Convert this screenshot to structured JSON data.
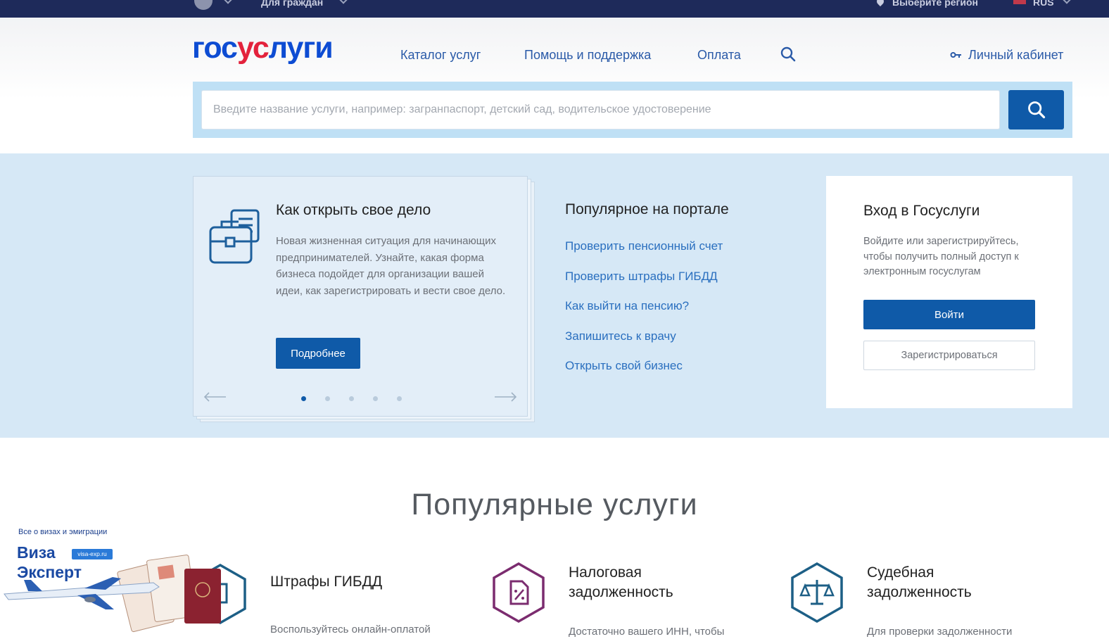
{
  "topbar": {
    "citizens_label": "Для граждан",
    "region_label": "Выберите регион",
    "lang_label": "RUS"
  },
  "header": {
    "logo_part1": "гос",
    "logo_part2": "ус",
    "logo_part3": "луги",
    "nav": [
      "Каталог услуг",
      "Помощь и поддержка",
      "Оплата"
    ],
    "cabinet_label": "Личный кабинет",
    "search_placeholder": "Введите название услуги, например: загранпаспорт, детский сад, водительское удостоверение"
  },
  "hero_card": {
    "title": "Как открыть свое дело",
    "text": "Новая жизненная ситуация для начинающих предпринимателей. Узнайте, какая форма бизнеса подойдет для организации вашей идеи, как зарегистрировать и вести свое дело.",
    "button": "Подробнее",
    "slides_total": 5,
    "slide_active": 1
  },
  "popular": {
    "title": "Популярное на портале",
    "links": [
      "Проверить пенсионный счет",
      "Проверить штрафы ГИБДД",
      "Как выйти на пенсию?",
      "Запишитесь к врачу",
      "Открыть свой бизнес"
    ]
  },
  "login": {
    "title": "Вход в Госуслуги",
    "text": "Войдите или зарегистрируйтесь, чтобы получить полный доступ к электронным госуслугам",
    "enter_button": "Войти",
    "register_button": "Зарегистрироваться"
  },
  "services": {
    "title": "Популярные услуги",
    "items": [
      {
        "title": "Штрафы ГИБДД",
        "desc": "Воспользуйтесь онлайн-оплатой",
        "icon": "document-icon"
      },
      {
        "title": "Налоговая\nзадолженность",
        "desc": "Достаточно вашего ИНН, чтобы",
        "icon": "tax-document-icon"
      },
      {
        "title": "Судебная\nзадолженность",
        "desc": "Для проверки задолженности",
        "icon": "scales-icon"
      }
    ]
  },
  "watermark": {
    "tagline": "Все о визах и эмиграции",
    "name_line1": "Виза",
    "name_line2": "Эксперт",
    "site": "visa-exp.ru"
  },
  "colors": {
    "topbar": "#1e2a5a",
    "primary": "#0f5aa8",
    "logo_blue": "#0d4cd3",
    "logo_red": "#e3223c",
    "link": "#2a6fbf",
    "hero_bg": "#d6e8f6",
    "service_icon_purple": "#7b2c6f",
    "service_icon_teal": "#1d5f86"
  }
}
